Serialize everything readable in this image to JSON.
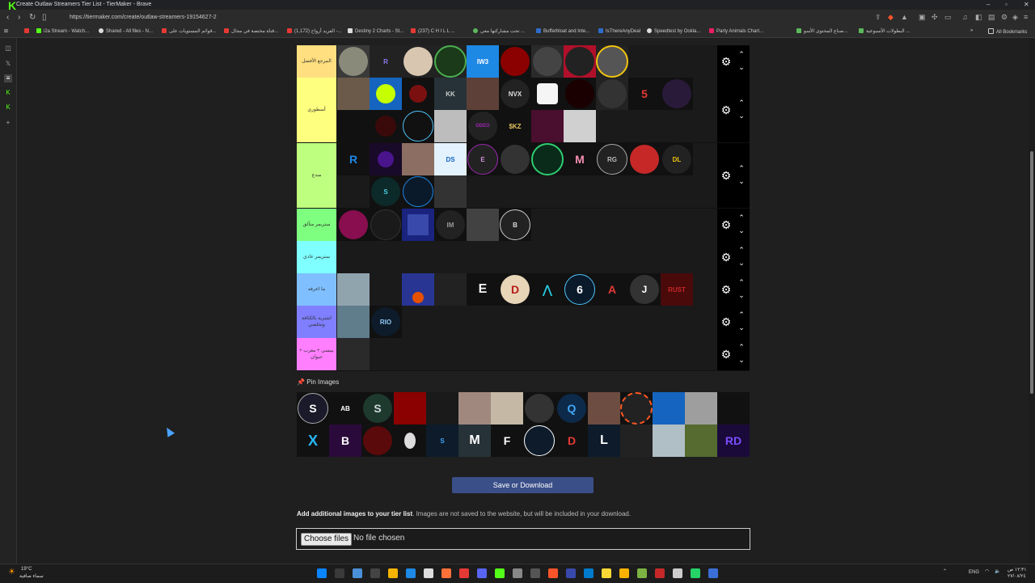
{
  "browser": {
    "window_title": "Create Outlaw Streamers Tier List - TierMaker - Brave",
    "url": "https://tiermaker.com/create/outlaw-streamers-19154627-2",
    "bookmarks": [
      "i2a Stream - Watch...",
      "Shared - All files - N...",
      "قوائم المستويات على...",
      "قناة مختصة في مجال...",
      "(1,172) الفريد أرواح -...",
      "Destiny 2 Charts - St...",
      "(237) C H I L L ...",
      "تحت مشاركتها معي ...",
      "Bufferbloat and Inte...",
      "IsThereAnyDeal",
      "Speedtest by Ookla...",
      "Party Animals Chart...",
      "صناع المحتوى الأسو...",
      "البطولات الأسبوعية ...",
      "All Bookmarks"
    ]
  },
  "tiers": [
    {
      "label": "المرجع الأفضل",
      "color": "#ffdf7f",
      "tiles": [
        "R",
        "",
        "",
        "IW3",
        "",
        "",
        "",
        "",
        ""
      ]
    },
    {
      "label": "أسطوري",
      "color": "#ffff7f",
      "tiles": [
        "",
        "",
        "",
        "KK",
        "",
        "NVX",
        "",
        "",
        "",
        "5",
        "",
        "",
        "",
        "",
        "",
        "$KZ",
        "",
        ""
      ]
    },
    {
      "label": "مبدع",
      "color": "#bfff7f",
      "tiles": [
        "R",
        "",
        "",
        "DS",
        "E",
        "",
        "",
        "M",
        "RG",
        "",
        "DL",
        "",
        "S",
        "",
        ""
      ]
    },
    {
      "label": "ستريمر متألق",
      "color": "#7fff7f",
      "tiles": [
        "",
        "",
        "",
        "IM",
        "",
        "B"
      ]
    },
    {
      "label": "ستريمر عادي",
      "color": "#7fffff",
      "tiles": []
    },
    {
      "label": "ما اعرفه",
      "color": "#7fbfff",
      "tiles": [
        "",
        "",
        "",
        "",
        "E",
        "D",
        "",
        "6",
        "A",
        "J",
        "RUST"
      ]
    },
    {
      "label": "اشتريه بالكثافة وتخلصي",
      "color": "#7f7fff",
      "tiles": [
        "",
        "RIO"
      ]
    },
    {
      "label": "بيبسي + مغرب + جيوان",
      "color": "#ff7fff",
      "tiles": [
        ""
      ]
    }
  ],
  "pin_images_label": "Pin Images",
  "pool_tiles": [
    "S",
    "AB",
    "S",
    "",
    "",
    "",
    "",
    "",
    "Q",
    "",
    "",
    "",
    "",
    "",
    "X",
    "B",
    "",
    "",
    "S",
    "M",
    "F",
    "",
    "D",
    "L",
    "",
    "",
    "",
    "RD"
  ],
  "save_label": "Save or Download",
  "add_images_bold": "Add additional images to your tier list",
  "add_images_text": ". Images are not saved to the website, but will be included in your download.",
  "file_button": "Choose files",
  "file_status": "No file chosen",
  "taskbar": {
    "weather": "19°C",
    "weather_sub": "سماء صافية",
    "lang": "ENG",
    "time": "١٢:٣١ ص",
    "date": "٢٧/٠٨/٢٤"
  }
}
